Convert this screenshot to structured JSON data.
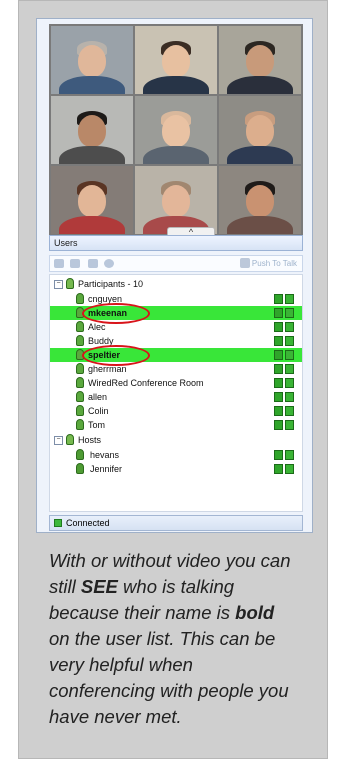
{
  "video_panel": {
    "tiles": [
      {
        "name": "participant-1-video"
      },
      {
        "name": "participant-2-video"
      },
      {
        "name": "participant-3-video"
      },
      {
        "name": "participant-4-video"
      },
      {
        "name": "participant-5-video"
      },
      {
        "name": "participant-6-video"
      },
      {
        "name": "participant-7-video"
      },
      {
        "name": "participant-8-video"
      },
      {
        "name": "participant-9-video"
      }
    ],
    "collapse_glyph": "^"
  },
  "users_section": {
    "title": "Users"
  },
  "toolbar": {
    "push_to_talk_label": "Push To Talk"
  },
  "tree": {
    "participants_group_label": "Participants - 10",
    "participants": [
      {
        "name": "cnguyen",
        "talking": false
      },
      {
        "name": "mkeenan",
        "talking": true
      },
      {
        "name": "Alec",
        "talking": false
      },
      {
        "name": "Buddy",
        "talking": false
      },
      {
        "name": "speltier",
        "talking": true
      },
      {
        "name": "gherrman",
        "talking": false
      },
      {
        "name": "WiredRed Conference Room",
        "talking": false
      },
      {
        "name": "allen",
        "talking": false
      },
      {
        "name": "Colin",
        "talking": false
      },
      {
        "name": "Tom",
        "talking": false
      }
    ],
    "hosts_group_label": "Hosts",
    "hosts": [
      {
        "name": "hevans"
      },
      {
        "name": "Jennifer"
      }
    ],
    "expand_glyph": "−"
  },
  "status_bar": {
    "text": "Connected"
  },
  "caption": {
    "part1": "With or without video you can still ",
    "emph1": "SEE",
    "part2": " who is talking because their name is ",
    "emph2": "bold",
    "part3": " on the user list. This can be very helpful when conferencing with people you have never met."
  },
  "colors": {
    "talking_highlight": "#39e639",
    "annotation_circle": "#d8141a",
    "panel_background": "#cfcfcf"
  }
}
